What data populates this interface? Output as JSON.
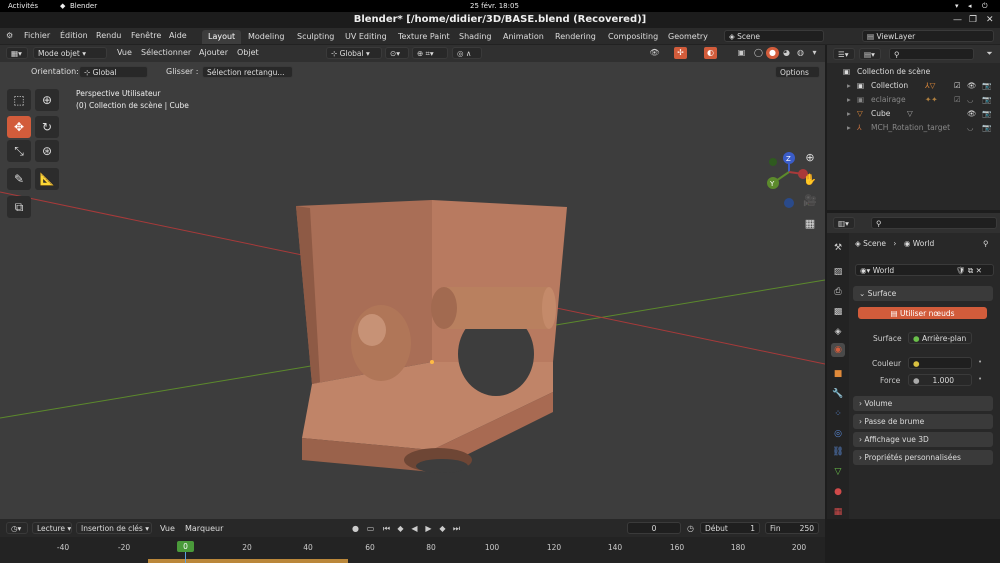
{
  "gnome": {
    "activities": "Activités",
    "app": "Blender",
    "clock": "25 févr.  18:05"
  },
  "window": {
    "title": "Blender* [/home/didier/3D/BASE.blend (Recovered)]"
  },
  "menu": [
    "Fichier",
    "Édition",
    "Rendu",
    "Fenêtre",
    "Aide"
  ],
  "workspaces": [
    "Layout",
    "Modeling",
    "Sculpting",
    "UV Editing",
    "Texture Paint",
    "Shading",
    "Animation",
    "Rendering",
    "Compositing",
    "Geometry No"
  ],
  "scene_name": "Scene",
  "viewlayer_name": "ViewLayer",
  "viewport_header": {
    "mode": "Mode objet",
    "vue": "Vue",
    "select": "Sélectionner",
    "add": "Ajouter",
    "object": "Objet",
    "transform": "Global"
  },
  "tool_settings": {
    "orientation_label": "Orientation:",
    "orientation": "Global",
    "drag_label": "Glisser :",
    "drag": "Sélection rectangu...",
    "options": "Options"
  },
  "viewport_info": {
    "line1": "Perspective Utilisateur",
    "line2": "(0) Collection de scène | Cube"
  },
  "gizmo": {
    "z": "Z",
    "y": "Y"
  },
  "outliner": {
    "root": "Collection de scène",
    "items": [
      {
        "name": "Collection",
        "muted": false
      },
      {
        "name": "eclairage",
        "muted": true
      },
      {
        "name": "Cube",
        "muted": false
      },
      {
        "name": "MCH_Rotation_target",
        "muted": true
      }
    ]
  },
  "props": {
    "breadcrumb_scene": "Scene",
    "breadcrumb_world": "World",
    "world_name": "World",
    "surface_panel": "Surface",
    "use_nodes": "Utiliser nœuds",
    "surface_label": "Surface",
    "surface_value": "Arrière-plan",
    "color_label": "Couleur",
    "strength_label": "Force",
    "strength_value": "1.000",
    "panels": [
      "Volume",
      "Passe de brume",
      "Affichage vue 3D",
      "Propriétés personnalisées"
    ]
  },
  "timeline": {
    "playback": "Lecture",
    "keying": "Insertion de clés",
    "view": "Vue",
    "marker": "Marqueur",
    "current_frame": "0",
    "start_label": "Début",
    "start": "1",
    "end_label": "Fin",
    "end": "250",
    "ticks": [
      "-40",
      "-20",
      "0",
      "20",
      "40",
      "60",
      "80",
      "100",
      "120",
      "140",
      "160",
      "180",
      "200"
    ],
    "current_marker": "0"
  },
  "colors": {
    "accent": "#d25c3b",
    "object": "#c08468",
    "x_axis": "#a83a3a",
    "y_axis": "#5c8a2c",
    "z_axis": "#3a5cc8"
  }
}
